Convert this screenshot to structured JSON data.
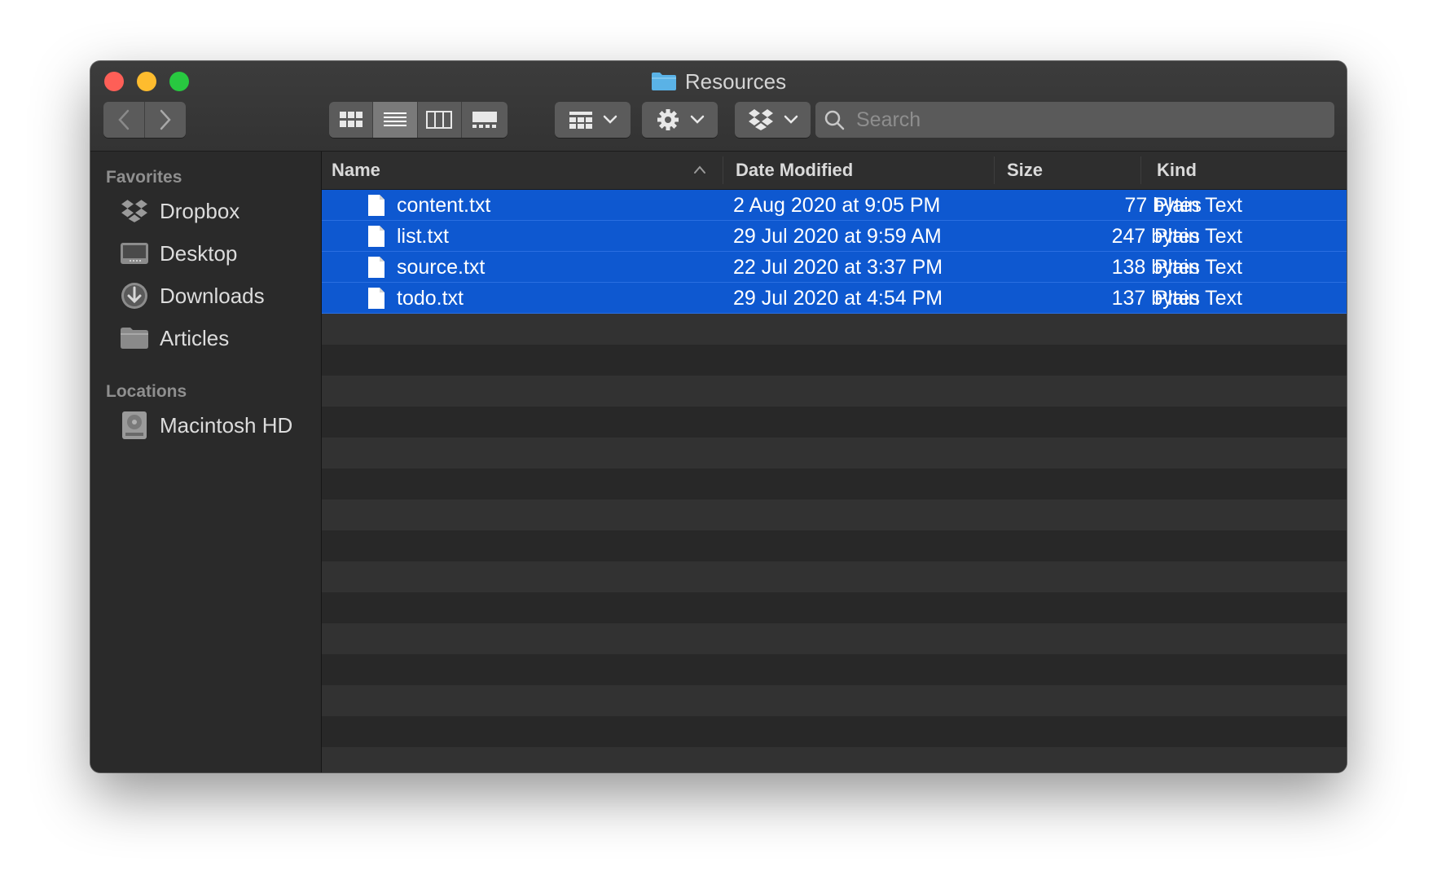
{
  "window": {
    "title": "Resources"
  },
  "toolbar": {
    "back_label": "‹",
    "forward_label": "›",
    "search_placeholder": "Search"
  },
  "sidebar": {
    "favorites_heading": "Favorites",
    "favorites": [
      {
        "label": "Dropbox",
        "icon": "dropbox-icon"
      },
      {
        "label": "Desktop",
        "icon": "desktop-icon"
      },
      {
        "label": "Downloads",
        "icon": "downloads-icon"
      },
      {
        "label": "Articles",
        "icon": "folder-icon"
      }
    ],
    "locations_heading": "Locations",
    "locations": [
      {
        "label": "Macintosh HD",
        "icon": "hard-drive-icon"
      }
    ]
  },
  "list": {
    "columns": {
      "name": "Name",
      "date": "Date Modified",
      "size": "Size",
      "kind": "Kind"
    },
    "sort": "Name ascending",
    "files": [
      {
        "name": "content.txt",
        "date": "2 Aug 2020 at 9:05 PM",
        "size": "77 bytes",
        "kind": "Plain Text",
        "selected": true
      },
      {
        "name": "list.txt",
        "date": "29 Jul 2020 at 9:59 AM",
        "size": "247 bytes",
        "kind": "Plain Text",
        "selected": true
      },
      {
        "name": "source.txt",
        "date": "22 Jul 2020 at 3:37 PM",
        "size": "138 bytes",
        "kind": "Plain Text",
        "selected": true
      },
      {
        "name": "todo.txt",
        "date": "29 Jul 2020 at 4:54 PM",
        "size": "137 bytes",
        "kind": "Plain Text",
        "selected": true
      }
    ]
  },
  "colors": {
    "selection": "#0e58d0",
    "accent_folder": "#5ab2e6"
  }
}
